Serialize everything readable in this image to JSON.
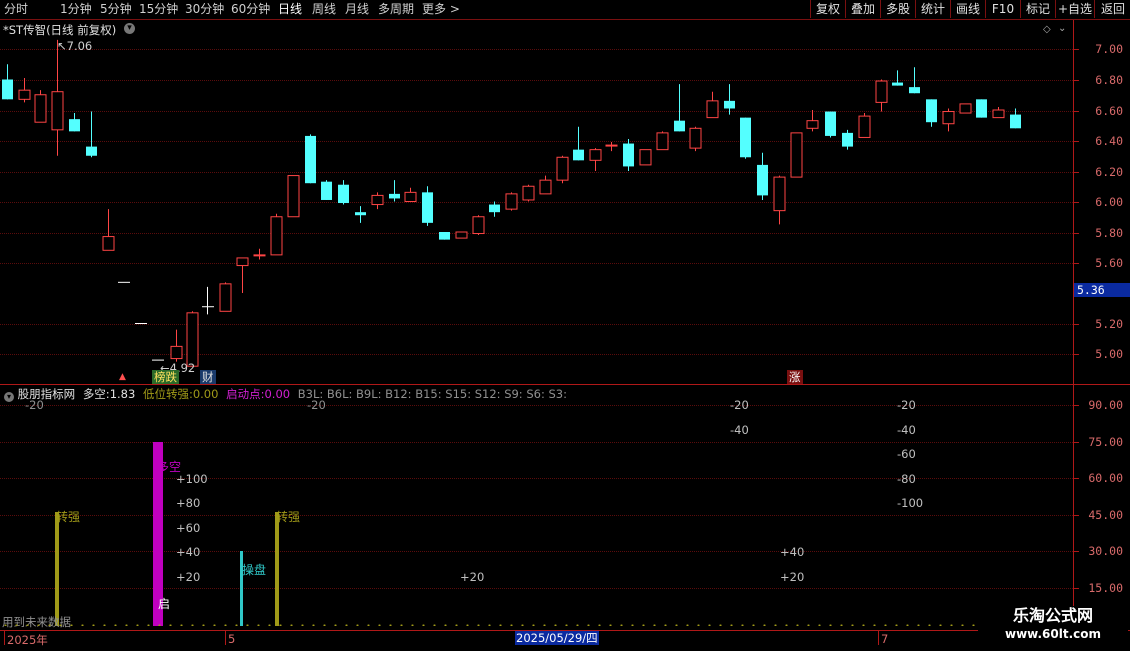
{
  "toolbar": {
    "periods": [
      "分时",
      "1分钟",
      "5分钟",
      "15分钟",
      "30分钟",
      "60分钟",
      "日线",
      "周线",
      "月线",
      "多周期",
      "更多 >"
    ],
    "active_period": "日线",
    "right_buttons": [
      "复权",
      "叠加",
      "多股",
      "统计",
      "画线",
      "F10",
      "标记",
      "+自选",
      "返回"
    ]
  },
  "main_chart": {
    "title": "*ST传智(日线 前复权)",
    "high_label": "7.06",
    "low_label": "4.92",
    "price_marker": "5.36",
    "badge_1": "榜跌",
    "badge_2": "财",
    "badge_3": "涨",
    "y_ticks": [
      "7.00",
      "6.80",
      "6.60",
      "6.40",
      "6.20",
      "6.00",
      "5.80",
      "5.60",
      "5.20",
      "5.00"
    ]
  },
  "indicator": {
    "name": "股朋指标网",
    "duokong_label": "多空:",
    "duokong_value": "1.83",
    "diwei_label": "低位转强:",
    "diwei_value": "0.00",
    "qidong_label": "启动点:",
    "qidong_value": "0.00",
    "signals": "B3L: B6L: B9L: B12: B15: S15: S12: S9: S6: S3:",
    "y_ticks": [
      "90.00",
      "75.00",
      "60.00",
      "45.00",
      "30.00",
      "15.00"
    ],
    "annotations": {
      "zhuanqiang_1": "转强",
      "duokong": "多空",
      "qi": "启",
      "caopan": "操盘",
      "zhuanqiang_2": "转强",
      "future_note": "用到未来数据"
    },
    "scale_a": [
      "+100",
      "+80",
      "+60",
      "+40",
      "+20"
    ],
    "scale_b": [
      "+20"
    ],
    "scale_c": [
      "+40",
      "+20"
    ],
    "scale_d": [
      "-20",
      "-40"
    ],
    "scale_e": [
      "-20",
      "-40",
      "-60",
      "-80",
      "-100"
    ],
    "top_marks": [
      "-20",
      "-20"
    ]
  },
  "time_axis": {
    "year": "2025年",
    "month_5": "5",
    "cursor_date": "2025/05/29/四",
    "month_7": "7"
  },
  "watermark": {
    "title": "乐淘公式网",
    "url": "www.60lt.com"
  },
  "colors": {
    "up": "#ff4545",
    "down": "#54ffff",
    "axis": "#b01818",
    "olive": "#a09a18",
    "magenta": "#c000c0"
  }
}
